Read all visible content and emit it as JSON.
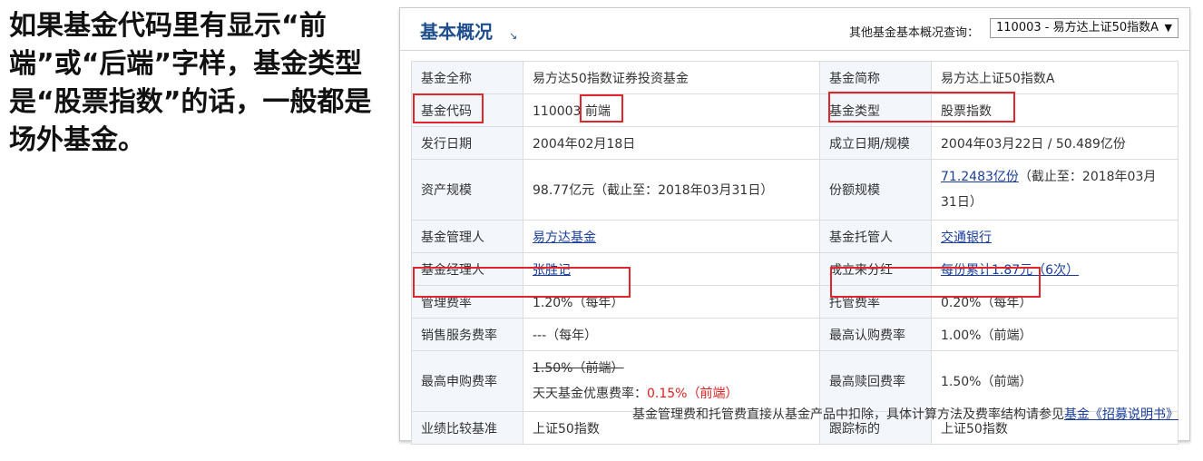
{
  "caption": "如果基金代码里有显示“前端”或“后端”字样，基金类型是“股票指数”的话，一般都是场外基金。",
  "panel": {
    "title": "基本概况",
    "title_arrow": "↘",
    "query_label": "其他基金基本概况查询：",
    "select_value": "110003 - 易方达上证50指数A",
    "select_arrow": "▼"
  },
  "rows": [
    {
      "l1": "基金全称",
      "v1": "易方达50指数证券投资基金",
      "l2": "基金简称",
      "v2": "易方达上证50指数A"
    },
    {
      "l1": "基金代码",
      "v1a": "110003",
      "v1b": "前端",
      "l2": "基金类型",
      "v2": "股票指数"
    },
    {
      "l1": "发行日期",
      "v1": "2004年02月18日",
      "l2": "成立日期/规模",
      "v2": "2004年03月22日 / 50.489亿份"
    },
    {
      "l1": "资产规模",
      "v1": "98.77亿元（截止至：2018年03月31日）",
      "l2": "份额规模",
      "v2_link": "71.2483亿份",
      "v2_rest": "（截止至：2018年03月31日）"
    },
    {
      "l1": "基金管理人",
      "v1_link": "易方达基金",
      "l2": "基金托管人",
      "v2_link": "交通银行"
    },
    {
      "l1": "基金经理人",
      "v1_link": "张胜记",
      "l2": "成立来分红",
      "v2_link": "每份累计1.87元（6次）"
    },
    {
      "l1": "管理费率",
      "v1": "1.20%（每年）",
      "l2": "托管费率",
      "v2": "0.20%（每年）"
    },
    {
      "l1": "销售服务费率",
      "v1": "---（每年）",
      "l2": "最高认购费率",
      "v2": "1.00%（前端）"
    },
    {
      "l1": "最高申购费率",
      "v1_strike": "1.50%（前端）",
      "v1_disc_label": "天天基金优惠费率：",
      "v1_disc_val": "0.15%（前端）",
      "l2": "最高赎回费率",
      "v2": "1.50%（前端）"
    },
    {
      "l1": "业绩比较基准",
      "v1": "上证50指数",
      "l2": "跟踪标的",
      "v2": "上证50指数"
    }
  ],
  "footer": {
    "text": "基金管理费和托管费直接从基金产品中扣除，具体计算方法及费率结构请参见",
    "link": "基金《招募说明书》"
  },
  "colors": {
    "highlight": "#e0262b",
    "link": "#1a3e99",
    "title": "#1f4e8c"
  }
}
